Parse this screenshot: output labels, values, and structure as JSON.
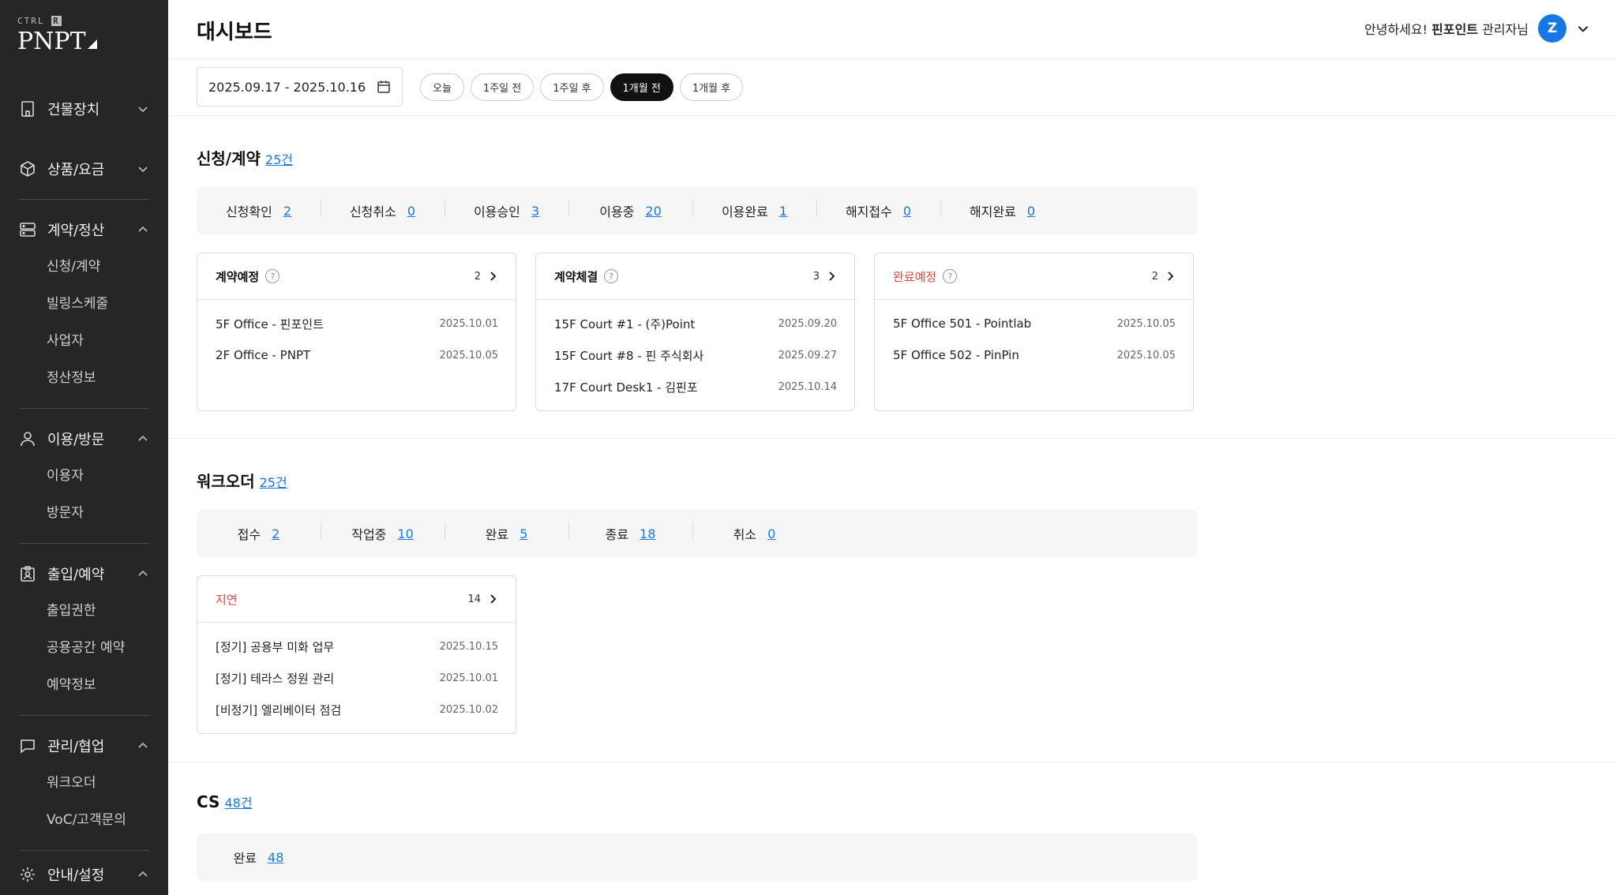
{
  "brand": {
    "top": "CTRL",
    "top_badge": "R",
    "main": "PNPT"
  },
  "sidebar": {
    "groups": [
      {
        "label": "건물장치",
        "icon": "building-icon",
        "expanded": false,
        "items": []
      },
      {
        "label": "상품/요금",
        "icon": "box-icon",
        "expanded": false,
        "items": []
      },
      {
        "label": "계약/정산",
        "icon": "server-icon",
        "expanded": true,
        "items": [
          "신청/계약",
          "빌링스케줄",
          "사업자",
          "정산정보"
        ]
      },
      {
        "label": "이용/방문",
        "icon": "user-icon",
        "expanded": true,
        "items": [
          "이용자",
          "방문자"
        ]
      },
      {
        "label": "출입/예약",
        "icon": "badge-icon",
        "expanded": true,
        "items": [
          "출입권한",
          "공용공간 예약",
          "예약정보"
        ]
      },
      {
        "label": "관리/협업",
        "icon": "chat-icon",
        "expanded": true,
        "items": [
          "워크오더",
          "VoC/고객문의"
        ]
      },
      {
        "label": "안내/설정",
        "icon": "gear-icon",
        "expanded": true,
        "items": []
      }
    ]
  },
  "header": {
    "title": "대시보드",
    "greeting_prefix": "안녕하세요!",
    "user_name": "핀포인트",
    "greeting_suffix": "관리자님",
    "avatar_initial": "Z"
  },
  "filter": {
    "date_range": "2025.09.17 - 2025.10.16",
    "chips": [
      "오늘",
      "1주일 전",
      "1주일 후",
      "1개월 전",
      "1개월 후"
    ],
    "active_chip": "1개월 전"
  },
  "contracts": {
    "title": "신청/계약",
    "count": "25건",
    "stats": [
      {
        "label": "신청확인",
        "value": "2"
      },
      {
        "label": "신청취소",
        "value": "0"
      },
      {
        "label": "이용승인",
        "value": "3"
      },
      {
        "label": "이용중",
        "value": "20"
      },
      {
        "label": "이용완료",
        "value": "1"
      },
      {
        "label": "해지접수",
        "value": "0"
      },
      {
        "label": "해지완료",
        "value": "0"
      }
    ],
    "cards": [
      {
        "title": "계약예정",
        "count": "2",
        "rows": [
          {
            "name": "5F Office - 핀포인트",
            "date": "2025.10.01"
          },
          {
            "name": "2F Office - PNPT",
            "date": "2025.10.05"
          }
        ]
      },
      {
        "title": "계약체결",
        "count": "3",
        "rows": [
          {
            "name": "15F Court #1  - (주)Point",
            "date": "2025.09.20"
          },
          {
            "name": "15F Court #8  - 핀 주식회사",
            "date": "2025.09.27"
          },
          {
            "name": "17F Court Desk1  - 김핀포",
            "date": "2025.10.14"
          }
        ]
      },
      {
        "title": "완료예정",
        "count": "2",
        "rows": [
          {
            "name": "5F Office 501 - Pointlab",
            "date": "2025.10.05"
          },
          {
            "name": "5F Office 502 - PinPin",
            "date": "2025.10.05"
          }
        ]
      }
    ]
  },
  "workorders": {
    "title": "워크오더",
    "count": "25건",
    "stats": [
      {
        "label": "접수",
        "value": "2"
      },
      {
        "label": "작업중",
        "value": "10"
      },
      {
        "label": "완료",
        "value": "5"
      },
      {
        "label": "종료",
        "value": "18"
      },
      {
        "label": "취소",
        "value": "0"
      }
    ],
    "delay_card": {
      "title": "지연",
      "count": "14",
      "rows": [
        {
          "name": "[정기] 공용부 미화 업무",
          "date": "2025.10.15"
        },
        {
          "name": "[정기] 테라스 정원 관리",
          "date": "2025.10.01"
        },
        {
          "name": "[비정기] 엘리베이터 점검",
          "date": "2025.10.02"
        }
      ]
    }
  },
  "cs": {
    "title": "CS",
    "count": "48건",
    "stats": [
      {
        "label": "완료",
        "value": "48"
      }
    ]
  },
  "colors": {
    "accent": "#1677e6",
    "alert": "#e8463a",
    "sidebar": "#262626"
  }
}
